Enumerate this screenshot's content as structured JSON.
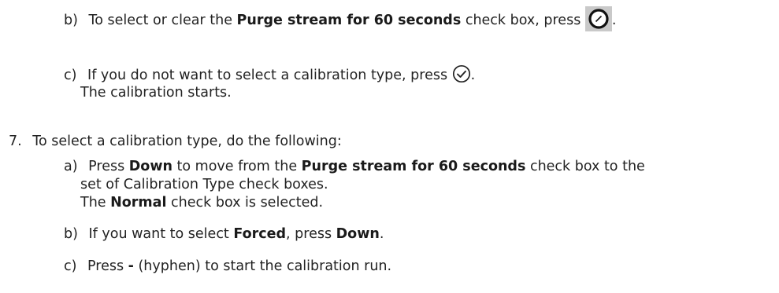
{
  "doc": {
    "step6b": {
      "marker": "b)",
      "text1": "To select or clear the ",
      "bold1": "Purge stream for 60 seconds",
      "text2": " check box, press ",
      "end": "."
    },
    "step6c": {
      "marker": "c)",
      "text1": "If you do not want to select a calibration type, press ",
      "end": ".",
      "result": "The calibration starts."
    },
    "step7": {
      "marker": "7.",
      "text": "To select a calibration type, do the following:"
    },
    "step7a": {
      "marker": "a)",
      "text1": "Press ",
      "bold1": "Down",
      "text2": " to move from the ",
      "bold2": "Purge stream for 60 seconds",
      "text3": " check box to the",
      "cont": "set of Calibration Type check boxes.",
      "result_text1": "The ",
      "result_bold": "Normal",
      "result_text2": " check box is selected."
    },
    "step7b": {
      "marker": "b)",
      "text1": "If you want to select ",
      "bold1": "Forced",
      "text2": ", press ",
      "bold2": "Down",
      "end": "."
    },
    "step7c": {
      "marker": "c)",
      "text1": "Press ",
      "bold1": "-",
      "text2": " (hyphen) to start the calibration run."
    }
  },
  "icons": {
    "dial_key": "dial-key-icon",
    "check_key": "checkmark-circle-icon"
  }
}
